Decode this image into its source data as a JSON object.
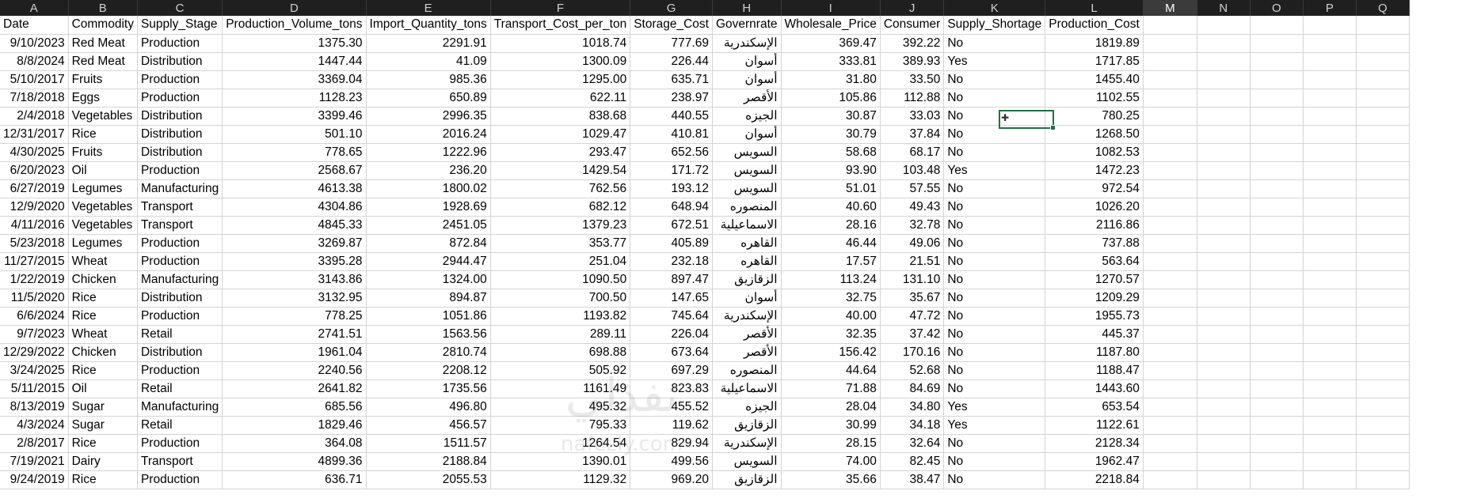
{
  "columns": [
    "A",
    "B",
    "C",
    "D",
    "E",
    "F",
    "G",
    "H",
    "I",
    "J",
    "K",
    "L",
    "M",
    "N",
    "O",
    "P",
    "Q"
  ],
  "selected_column": "M",
  "headers": [
    "Date",
    "Commodity",
    "Supply_Stage",
    "Production_Volume_tons",
    "Import_Quantity_tons",
    "Transport_Cost_per_ton",
    "Storage_Cost",
    "Governrate",
    "Wholesale_Price",
    "Consumer",
    "Supply_Shortage",
    "Production_Cost"
  ],
  "rows": [
    [
      "9/10/2023",
      "Red Meat",
      "Production",
      "1375.30",
      "2291.91",
      "1018.74",
      "777.69",
      "الإسكندرية",
      "369.47",
      "392.22",
      "No",
      "1819.89"
    ],
    [
      "8/8/2024",
      "Red Meat",
      "Distribution",
      "1447.44",
      "41.09",
      "1300.09",
      "226.44",
      "أسوان",
      "333.81",
      "389.93",
      "Yes",
      "1717.85"
    ],
    [
      "5/10/2017",
      "Fruits",
      "Production",
      "3369.04",
      "985.36",
      "1295.00",
      "635.71",
      "أسوان",
      "31.80",
      "33.50",
      "No",
      "1455.40"
    ],
    [
      "7/18/2018",
      "Eggs",
      "Production",
      "1128.23",
      "650.89",
      "622.11",
      "238.97",
      "الأقصر",
      "105.86",
      "112.88",
      "No",
      "1102.55"
    ],
    [
      "2/4/2018",
      "Vegetables",
      "Distribution",
      "3399.46",
      "2996.35",
      "838.68",
      "440.55",
      "الجيزه",
      "30.87",
      "33.03",
      "No",
      "780.25"
    ],
    [
      "12/31/2017",
      "Rice",
      "Distribution",
      "501.10",
      "2016.24",
      "1029.47",
      "410.81",
      "أسوان",
      "30.79",
      "37.84",
      "No",
      "1268.50"
    ],
    [
      "4/30/2025",
      "Fruits",
      "Distribution",
      "778.65",
      "1222.96",
      "293.47",
      "652.56",
      "السويس",
      "58.68",
      "68.17",
      "No",
      "1082.53"
    ],
    [
      "6/20/2023",
      "Oil",
      "Production",
      "2568.67",
      "236.20",
      "1429.54",
      "171.72",
      "السويس",
      "93.90",
      "103.48",
      "Yes",
      "1472.23"
    ],
    [
      "6/27/2019",
      "Legumes",
      "Manufacturing",
      "4613.38",
      "1800.02",
      "762.56",
      "193.12",
      "السويس",
      "51.01",
      "57.55",
      "No",
      "972.54"
    ],
    [
      "12/9/2020",
      "Vegetables",
      "Transport",
      "4304.86",
      "1928.69",
      "682.12",
      "648.94",
      "المنصوره",
      "40.60",
      "49.43",
      "No",
      "1026.20"
    ],
    [
      "4/11/2016",
      "Vegetables",
      "Transport",
      "4845.33",
      "2451.05",
      "1379.23",
      "672.51",
      "الاسماعيلية",
      "28.16",
      "32.78",
      "No",
      "2116.86"
    ],
    [
      "5/23/2018",
      "Legumes",
      "Production",
      "3269.87",
      "872.84",
      "353.77",
      "405.89",
      "القاهره",
      "46.44",
      "49.06",
      "No",
      "737.88"
    ],
    [
      "11/27/2015",
      "Wheat",
      "Production",
      "3395.28",
      "2944.47",
      "251.04",
      "232.18",
      "القاهره",
      "17.57",
      "21.51",
      "No",
      "563.64"
    ],
    [
      "1/22/2019",
      "Chicken",
      "Manufacturing",
      "3143.86",
      "1324.00",
      "1090.50",
      "897.47",
      "الزقازيق",
      "113.24",
      "131.10",
      "No",
      "1270.57"
    ],
    [
      "11/5/2020",
      "Rice",
      "Distribution",
      "3132.95",
      "894.87",
      "700.50",
      "147.65",
      "أسوان",
      "32.75",
      "35.67",
      "No",
      "1209.29"
    ],
    [
      "6/6/2024",
      "Rice",
      "Production",
      "778.25",
      "1051.86",
      "1193.82",
      "745.64",
      "الإسكندرية",
      "40.00",
      "47.72",
      "No",
      "1955.73"
    ],
    [
      "9/7/2023",
      "Wheat",
      "Retail",
      "2741.51",
      "1563.56",
      "289.11",
      "226.04",
      "الأقصر",
      "32.35",
      "37.42",
      "No",
      "445.37"
    ],
    [
      "12/29/2022",
      "Chicken",
      "Distribution",
      "1961.04",
      "2810.74",
      "698.88",
      "673.64",
      "الأقصر",
      "156.42",
      "170.16",
      "No",
      "1187.80"
    ],
    [
      "3/24/2025",
      "Rice",
      "Production",
      "2240.56",
      "2208.12",
      "505.92",
      "697.29",
      "المنصوره",
      "44.64",
      "52.68",
      "No",
      "1188.47"
    ],
    [
      "5/11/2015",
      "Oil",
      "Retail",
      "2641.82",
      "1735.56",
      "1161.49",
      "823.83",
      "الاسماعيلية",
      "71.88",
      "84.69",
      "No",
      "1443.60"
    ],
    [
      "8/13/2019",
      "Sugar",
      "Manufacturing",
      "685.56",
      "496.80",
      "495.32",
      "455.52",
      "الجيزه",
      "28.04",
      "34.80",
      "Yes",
      "653.54"
    ],
    [
      "4/3/2024",
      "Sugar",
      "Retail",
      "1829.46",
      "456.57",
      "795.33",
      "119.62",
      "الزقازيق",
      "30.99",
      "34.18",
      "Yes",
      "1122.61"
    ],
    [
      "2/8/2017",
      "Rice",
      "Production",
      "364.08",
      "1511.57",
      "1264.54",
      "829.94",
      "الإسكندرية",
      "28.15",
      "32.64",
      "No",
      "2128.34"
    ],
    [
      "7/19/2021",
      "Dairy",
      "Transport",
      "4899.36",
      "2188.84",
      "1390.01",
      "499.56",
      "السويس",
      "74.00",
      "82.45",
      "No",
      "1962.47"
    ],
    [
      "9/24/2019",
      "Rice",
      "Production",
      "636.71",
      "2055.53",
      "1129.32",
      "969.20",
      "الزقازيق",
      "35.66",
      "38.47",
      "No",
      "2218.84"
    ]
  ],
  "watermark": {
    "text": "نفذلي",
    "subtext": "nafezly.com"
  }
}
